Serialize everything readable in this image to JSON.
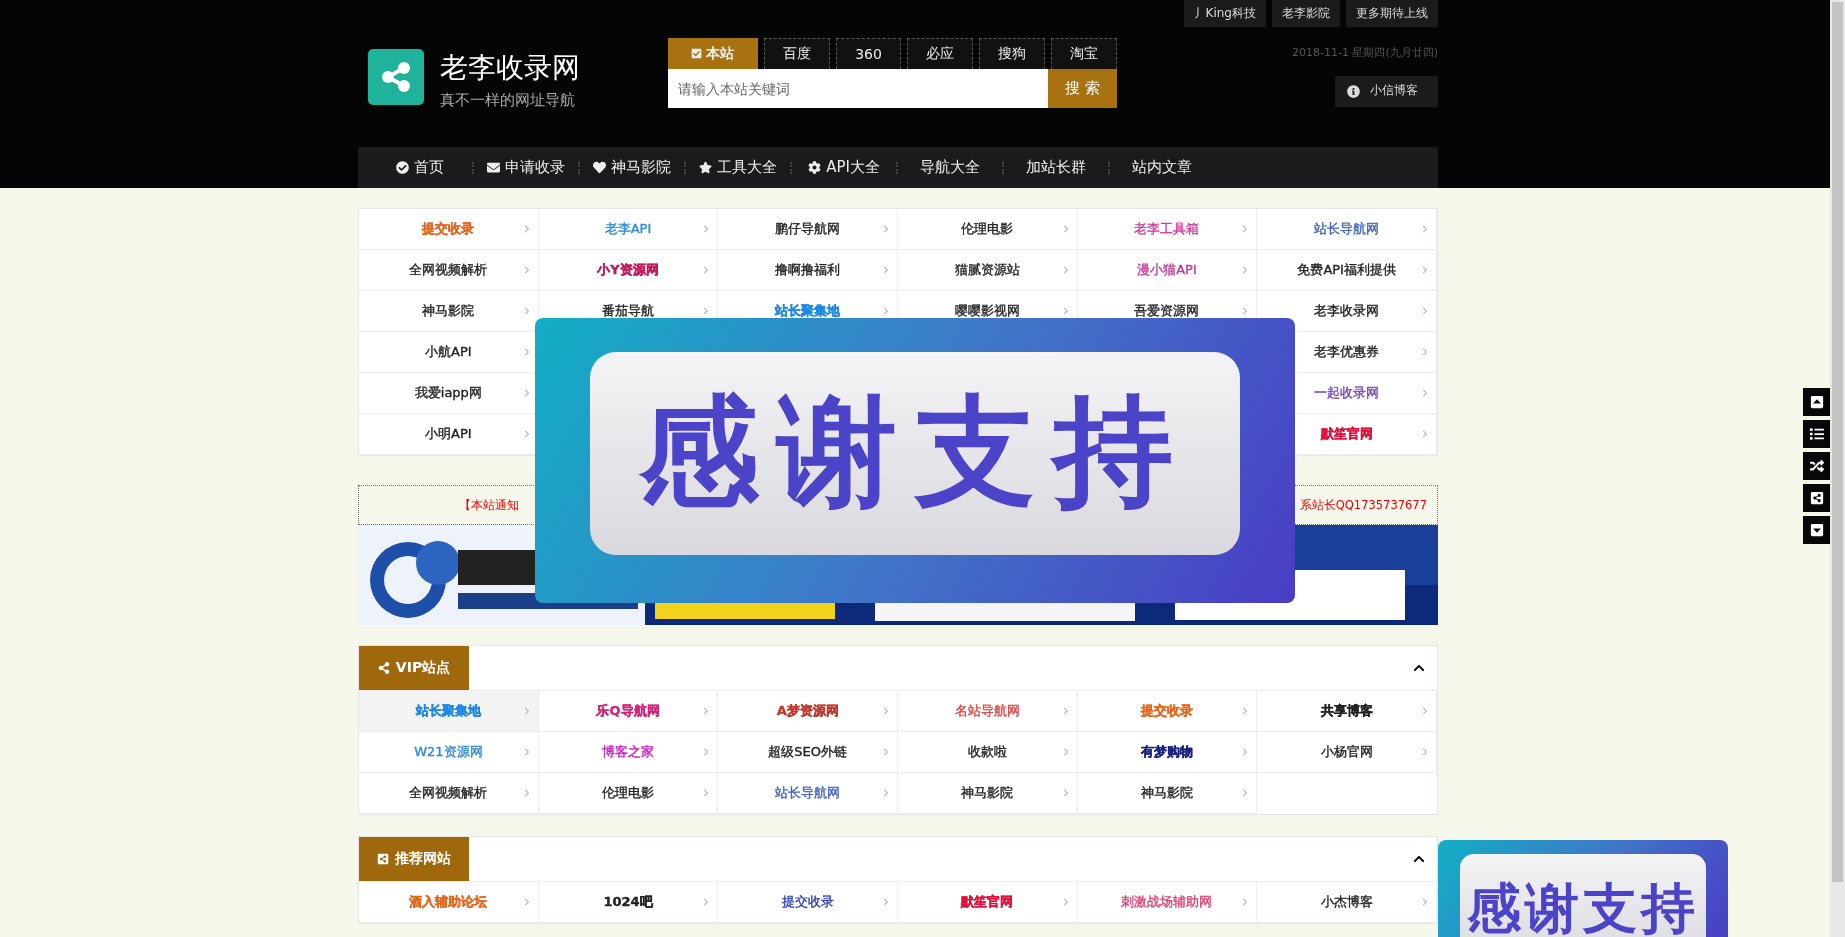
{
  "top_links": [
    "丿King科技",
    "老李影院",
    "更多期待上线"
  ],
  "logo": {
    "title": "老李收录网",
    "subtitle": "真不一样的网址导航"
  },
  "search": {
    "tabs": [
      {
        "label": "本站",
        "selected": true
      },
      {
        "label": "百度",
        "selected": false
      },
      {
        "label": "360",
        "selected": false
      },
      {
        "label": "必应",
        "selected": false
      },
      {
        "label": "搜狗",
        "selected": false
      },
      {
        "label": "淘宝",
        "selected": false
      }
    ],
    "placeholder": "请输入本站关键词",
    "button": "搜 索"
  },
  "date": "2018-11-1 星期四(九月廿四)",
  "user_button": "小信博客",
  "nav": [
    "首页",
    "申请收录",
    "神马影院",
    "工具大全",
    "API大全",
    "导航大全",
    "加站长群",
    "站内文章"
  ],
  "link_grid": [
    [
      {
        "text": "提交收录",
        "color": "#e8661a",
        "bold": true
      },
      {
        "text": "老李API",
        "color": "#2b8ad6",
        "bold": false
      },
      {
        "text": "鹏仔导航网",
        "bold": false
      },
      {
        "text": "伦理电影",
        "bold": false
      },
      {
        "text": "老李工具箱",
        "color": "#d4379a",
        "bold": false
      },
      {
        "text": "站长导航网",
        "color": "#3f5fc0",
        "bold": false
      }
    ],
    [
      {
        "text": "全网视频解析",
        "bold": false
      },
      {
        "text": "小Y资源网",
        "color": "#c2185b",
        "bold": true
      },
      {
        "text": "撸啊撸福利",
        "bold": false
      },
      {
        "text": "猫腻资源站",
        "bold": false
      },
      {
        "text": "漫小猫API",
        "color": "#c0399a",
        "bold": false
      },
      {
        "text": "免费API福利提供",
        "bold": false
      }
    ],
    [
      {
        "text": "神马影院",
        "bold": false
      },
      {
        "text": "番茄导航",
        "bold": false
      },
      {
        "text": "站长聚集地",
        "color": "#1e88e5",
        "bold": true
      },
      {
        "text": "嘤嘤影视网",
        "bold": false
      },
      {
        "text": "吾爱资源网",
        "bold": false
      },
      {
        "text": "老李收录网",
        "bold": false
      }
    ],
    [
      {
        "text": "小航API",
        "bold": false
      },
      {
        "text": "老李优惠券",
        "bold": false
      }
    ],
    [
      {
        "text": "我爱iapp网",
        "bold": false
      },
      {
        "text": "一起收录网",
        "color": "#7b3fc0",
        "bold": false
      }
    ],
    [
      {
        "text": "小明API",
        "bold": false
      },
      {
        "text": "默笙官网",
        "color": "#e0103a",
        "bold": true
      }
    ]
  ],
  "notice": {
    "left": "【本站通知",
    "right": "系站长QQ1735737677"
  },
  "banners": [
    {
      "kind": "picture"
    },
    {
      "kind": "picture"
    }
  ],
  "sections": [
    {
      "title": "VIP站点",
      "expanded": true,
      "items": [
        {
          "text": "站长聚集地",
          "color": "#1e88e5",
          "bold": true,
          "selected": true
        },
        {
          "text": "乐Q导航网",
          "color": "#d4237a",
          "bold": true,
          "selected": false
        },
        {
          "text": "A梦资源网",
          "color": "#c0392b",
          "bold": true,
          "selected": false
        },
        {
          "text": "名站导航网",
          "color": "#e04040",
          "bold": false,
          "selected": false
        },
        {
          "text": "提交收录",
          "color": "#e8661a",
          "bold": true,
          "selected": false
        },
        {
          "text": "共享博客",
          "bold": true,
          "selected": false
        },
        {
          "text": "W21资源网",
          "color": "#2b8ad6",
          "bold": false,
          "selected": false
        },
        {
          "text": "博客之家",
          "color": "#c41fb8",
          "bold": false,
          "selected": false
        },
        {
          "text": "超级SEO外链",
          "bold": false,
          "selected": false
        },
        {
          "text": "收款啦",
          "bold": false,
          "selected": false
        },
        {
          "text": "有梦购物",
          "color": "#1a237e",
          "bold": true,
          "selected": false
        },
        {
          "text": "小杨官网",
          "bold": false,
          "selected": false
        },
        {
          "text": "全网视频解析",
          "bold": false,
          "selected": false
        },
        {
          "text": "伦理电影",
          "bold": false,
          "selected": false
        },
        {
          "text": "站长导航网",
          "color": "#3f5fc0",
          "bold": false,
          "selected": false
        },
        {
          "text": "神马影院",
          "bold": false,
          "selected": false
        },
        {
          "text": "神马影院",
          "bold": false,
          "selected": false
        }
      ]
    },
    {
      "title": "推荐网站",
      "expanded": true,
      "items": [
        {
          "text": "酒入辅助论坛",
          "color": "#e8661a",
          "bold": true,
          "selected": false
        },
        {
          "text": "1024吧",
          "bold": true,
          "selected": false
        },
        {
          "text": "提交收录",
          "color": "#2a3cb0",
          "bold": false,
          "selected": false
        },
        {
          "text": "默笙官网",
          "color": "#e0103a",
          "bold": true,
          "selected": false
        },
        {
          "text": "刺激战场辅助网",
          "color": "#e04070",
          "bold": false,
          "selected": false
        },
        {
          "text": "小杰博客",
          "bold": false,
          "selected": false
        }
      ]
    }
  ],
  "popups": [
    {
      "text": "感谢支持"
    },
    {
      "text": "感谢支持"
    }
  ]
}
